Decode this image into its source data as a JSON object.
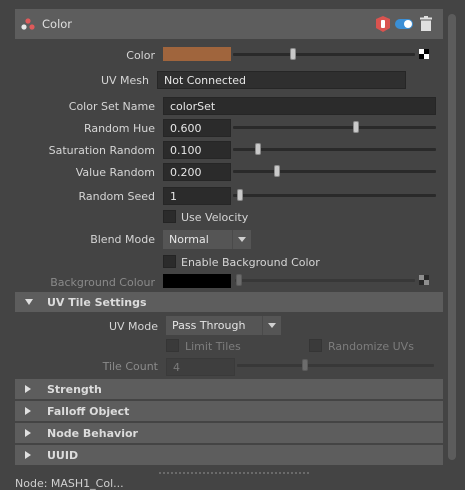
{
  "panel": {
    "title": "Color",
    "icons": {
      "node": "color-node-icon",
      "shield": "shield-icon",
      "toggle": "toggle-icon",
      "delete": "trash-icon"
    }
  },
  "fields": {
    "color_label": "Color",
    "color_value_hex": "#a0653d",
    "uv_mesh_label": "UV Mesh",
    "uv_mesh_value": "Not Connected",
    "color_set_label": "Color Set Name",
    "color_set_value": "colorSet",
    "random_hue_label": "Random Hue",
    "random_hue_value": "0.600",
    "saturation_label": "Saturation Random",
    "saturation_value": "0.100",
    "value_random_label": "Value Random",
    "value_random_value": "0.200",
    "seed_label": "Random Seed",
    "seed_value": "1",
    "use_velocity_label": "Use Velocity",
    "blend_mode_label": "Blend Mode",
    "blend_mode_value": "Normal",
    "enable_bg_label": "Enable Background Color",
    "bg_colour_label": "Background Colour",
    "bg_colour_hex": "#000000"
  },
  "uv_tile": {
    "title": "UV Tile Settings",
    "uv_mode_label": "UV Mode",
    "uv_mode_value": "Pass Through",
    "limit_tiles_label": "Limit Tiles",
    "randomize_uvs_label": "Randomize UVs",
    "tile_count_label": "Tile Count",
    "tile_count_value": "4"
  },
  "sections": {
    "strength": "Strength",
    "falloff": "Falloff Object",
    "node_behavior": "Node Behavior",
    "uuid": "UUID"
  },
  "footer": {
    "cutoff_text": "Node: MASH1_Col..."
  }
}
